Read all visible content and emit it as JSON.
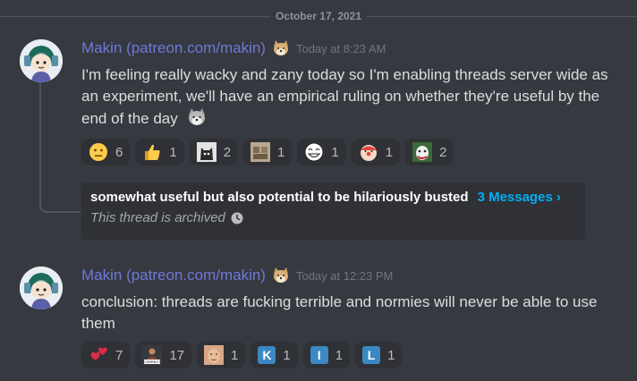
{
  "divider": {
    "date": "October 17, 2021"
  },
  "colors": {
    "username": "#6f78d9",
    "link": "#00aff4",
    "background": "#36393f",
    "reaction_bg": "#2f3136"
  },
  "messages": [
    {
      "username": "Makin (patreon.com/makin)",
      "badge_icon": "shiba-dog-emoji",
      "timestamp": "Today at 8:23 AM",
      "text": "I'm feeling really wacky and zany today so I'm enabling threads server wide as an experiment, we'll have an empirical ruling on whether they're useful by the end of the day",
      "inline_emoji": "shiba-dog-emoji",
      "reactions": [
        {
          "icon": "neutral-face-emoji",
          "count": "6"
        },
        {
          "icon": "thumbs-up-emoji",
          "count": "1"
        },
        {
          "icon": "cat-meme-emoji",
          "count": "2"
        },
        {
          "icon": "cursed-meme-emoji",
          "count": "1"
        },
        {
          "icon": "troll-face-emoji",
          "count": "1"
        },
        {
          "icon": "clown-meme-emoji",
          "count": "1"
        },
        {
          "icon": "joker-emoji",
          "count": "2"
        }
      ],
      "thread": {
        "title": "somewhat useful but also potential to be hilariously busted",
        "link_text": "3 Messages ›",
        "status": "This thread is archived",
        "status_icon": "clock-icon"
      }
    },
    {
      "username": "Makin (patreon.com/makin)",
      "badge_icon": "shiba-dog-emoji",
      "timestamp": "Today at 12:23 PM",
      "text": "conclusion: threads are fucking terrible and normies will never be able to use them",
      "reactions": [
        {
          "icon": "two-hearts-emoji",
          "count": "7"
        },
        {
          "icon": "correct-meme-emoji",
          "count": "17"
        },
        {
          "icon": "face-meme-emoji",
          "count": "1"
        },
        {
          "icon": "letter-k-emoji",
          "letter": "K",
          "count": "1"
        },
        {
          "icon": "letter-i-emoji",
          "letter": "I",
          "count": "1"
        },
        {
          "icon": "letter-l-emoji",
          "letter": "L",
          "count": "1"
        }
      ]
    }
  ]
}
